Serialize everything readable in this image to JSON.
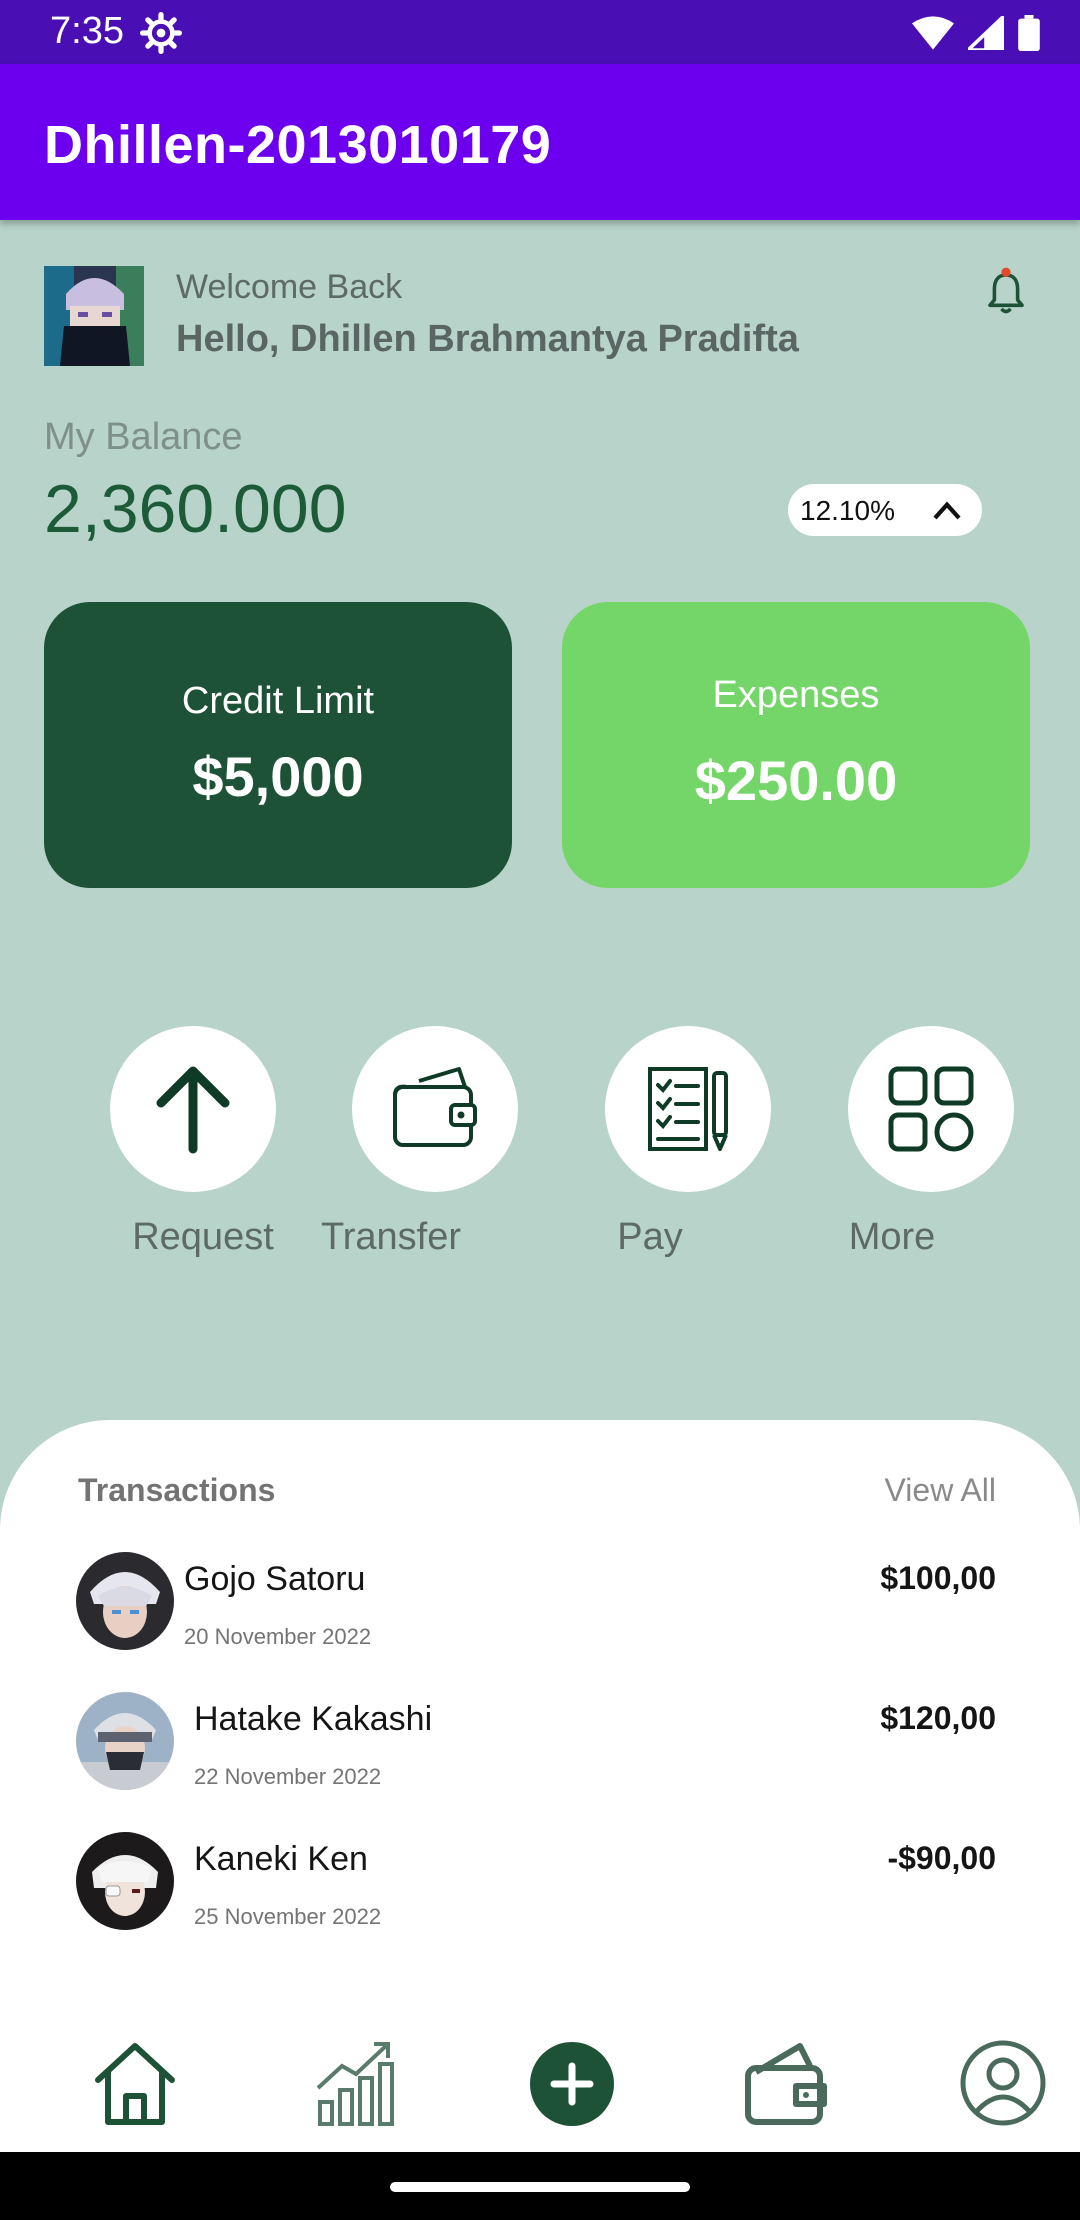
{
  "status_bar": {
    "time": "7:35"
  },
  "app_bar": {
    "title": "Dhillen-2013010179"
  },
  "profile": {
    "welcome": "Welcome Back",
    "hello": "Hello, Dhillen Brahmantya Pradifta"
  },
  "balance": {
    "label": "My Balance",
    "value": "2,360.000",
    "percent": "12.10%"
  },
  "cards": {
    "credit": {
      "label": "Credit Limit",
      "value": "$5,000"
    },
    "expenses": {
      "label": "Expenses",
      "value": "$250.00"
    }
  },
  "actions": [
    {
      "label": "Request",
      "icon": "arrow-up-icon"
    },
    {
      "label": "Transfer",
      "icon": "wallet-icon"
    },
    {
      "label": "Pay",
      "icon": "checklist-icon"
    },
    {
      "label": "More",
      "icon": "grid-icon"
    }
  ],
  "transactions": {
    "title": "Transactions",
    "view_all": "View All",
    "items": [
      {
        "name": "Gojo Satoru",
        "date": "20 November 2022",
        "amount": "$100,00"
      },
      {
        "name": "Hatake Kakashi",
        "date": "22 November 2022",
        "amount": "$120,00"
      },
      {
        "name": "Kaneki Ken",
        "date": "25 November 2022",
        "amount": "-$90,00"
      }
    ]
  },
  "bottom_nav": [
    "home-icon",
    "chart-icon",
    "add-icon",
    "wallet-icon",
    "profile-icon"
  ],
  "colors": {
    "status_bar": "#4a0fb4",
    "app_bar": "#6c00ee",
    "background": "#b8d3ca",
    "dark_green": "#1e5236",
    "light_green": "#74d668"
  }
}
